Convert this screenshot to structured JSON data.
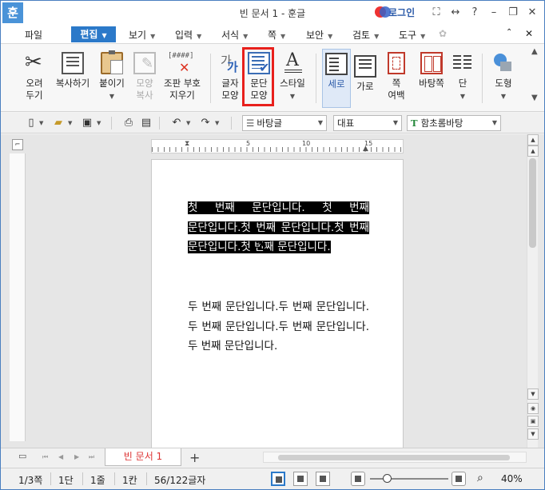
{
  "titlebar": {
    "app_icon": "훈",
    "title": "빈 문서 1 - 훈글",
    "login": "로그인",
    "icons": [
      "fullscreen-icon",
      "split-icon",
      "help-icon",
      "minimize-icon",
      "restore-icon",
      "close-icon"
    ]
  },
  "menu": {
    "file": "파일",
    "edit": "편집",
    "view": "보기",
    "insert": "입력",
    "format": "서식",
    "page": "쪽",
    "security": "보안",
    "review": "검토",
    "tools": "도구"
  },
  "ribbon": {
    "cut": [
      "오려",
      "두기"
    ],
    "copy": "복사하기",
    "paste": "붙이기",
    "format_copy": [
      "모양",
      "복사"
    ],
    "erase_symbol": [
      "조판 부호",
      "지우기"
    ],
    "char_shape": [
      "글자",
      "모양"
    ],
    "para_shape": [
      "문단",
      "모양"
    ],
    "style": "스타일",
    "portrait": "세로",
    "landscape": "가로",
    "page_margin": [
      "쪽",
      "여백"
    ],
    "page_pattern": "바탕쪽",
    "columns": "단",
    "shapes": "도형"
  },
  "toolbar2": {
    "style_combo": "바탕글",
    "language_combo": "대표",
    "font_combo": "함초롬바탕",
    "font_icon": "T"
  },
  "document": {
    "paragraph1": "첫 번째 문단입니다. 첫 번째 문단입니다.첫 번째 문단입니다.첫 번째 문단입니다.첫 번째 문단입니다.",
    "paragraph2": "두 번째 문단입니다.두 번째 문단입니다.두 번째 문단입니다.두 번째 문단입니다.두 번째 문단입니다."
  },
  "ruler": {
    "marks": [
      "5",
      "10",
      "15"
    ]
  },
  "tabs": {
    "doc_tab": "빈 문서 1",
    "add": "+"
  },
  "status": {
    "page": "1/3쪽",
    "column": "1단",
    "line": "1줄",
    "col": "1칸",
    "chars": "56/122글자",
    "zoom": "40%"
  },
  "colors": {
    "accent": "#2b79c9",
    "highlight_box": "#e8201c",
    "selection_bg": "#000000"
  }
}
